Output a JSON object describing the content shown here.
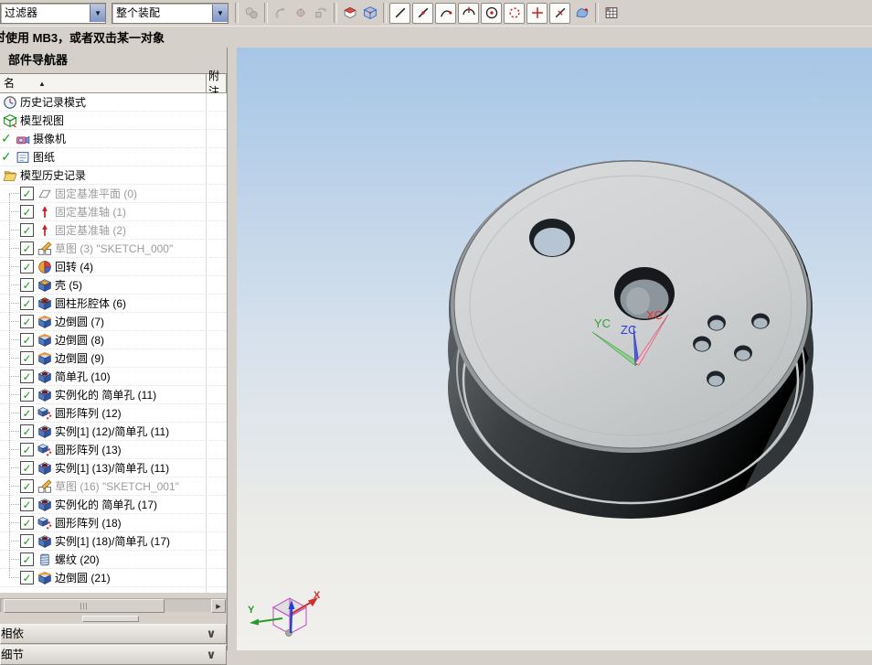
{
  "toolbar": {
    "filter_dropdown": {
      "value": "过滤器"
    },
    "scope_dropdown": {
      "value": "整个装配"
    },
    "icon_groups": [
      {
        "icons": [
          {
            "name": "component-preview-icon",
            "disabled": true
          }
        ]
      },
      {
        "icons": [
          {
            "name": "move-component-icon",
            "disabled": true
          },
          {
            "name": "rotate-component-icon",
            "disabled": true
          },
          {
            "name": "replace-component-icon",
            "disabled": true
          }
        ]
      },
      {
        "icons": [
          {
            "name": "edit-work-section-icon",
            "disabled": false
          },
          {
            "name": "clip-box-icon",
            "disabled": false
          }
        ]
      },
      {
        "icons": [
          {
            "name": "end-point-icon",
            "raised": true
          },
          {
            "name": "mid-point-icon",
            "raised": true
          },
          {
            "name": "control-point-icon",
            "raised": true
          },
          {
            "name": "quadrant-point-icon",
            "raised": true
          },
          {
            "name": "arc-center-point-icon",
            "raised": true
          },
          {
            "name": "existing-point-icon",
            "raised": true
          },
          {
            "name": "intersection-point-icon",
            "raised": true
          },
          {
            "name": "point-on-curve-icon",
            "raised": true
          },
          {
            "name": "point-on-face-icon",
            "disabled": false
          }
        ]
      },
      {
        "icons": [
          {
            "name": "spreadsheet-icon",
            "disabled": false
          }
        ]
      }
    ]
  },
  "statusbar": {
    "prefix_fragment": "时",
    "text": "使用 MB3，或者双击某一对象"
  },
  "navigator": {
    "title": "部件导航器",
    "columns": {
      "name": "名称",
      "sort_indicator": "▲",
      "note": "附注"
    },
    "rows": [
      {
        "label": "历史记录模式",
        "icon": "history",
        "check": "none",
        "child": false
      },
      {
        "label": "模型视图",
        "icon": "views",
        "check": "none",
        "child": false
      },
      {
        "label": "摄像机",
        "icon": "camera",
        "check": "mark",
        "child": false
      },
      {
        "label": "图纸",
        "icon": "sheet",
        "check": "mark",
        "child": false
      },
      {
        "label": "模型历史记录",
        "icon": "folder",
        "check": "none",
        "child": false
      },
      {
        "label": "固定基准平面 (0)",
        "icon": "plane",
        "check": "box",
        "child": true,
        "gray": true
      },
      {
        "label": "固定基准轴 (1)",
        "icon": "axis",
        "check": "box",
        "child": true,
        "gray": true
      },
      {
        "label": "固定基准轴 (2)",
        "icon": "axis",
        "check": "box",
        "child": true,
        "gray": true
      },
      {
        "label": "草图 (3) \"SKETCH_000\"",
        "icon": "sketch",
        "check": "box",
        "child": true,
        "gray": true
      },
      {
        "label": "回转 (4)",
        "icon": "revolve",
        "check": "box",
        "child": true
      },
      {
        "label": "壳 (5)",
        "icon": "shell",
        "check": "box",
        "child": true
      },
      {
        "label": "圆柱形腔体 (6)",
        "icon": "pocket",
        "check": "box",
        "child": true
      },
      {
        "label": "边倒圆 (7)",
        "icon": "blend",
        "check": "box",
        "child": true
      },
      {
        "label": "边倒圆 (8)",
        "icon": "blend",
        "check": "box",
        "child": true
      },
      {
        "label": "边倒圆 (9)",
        "icon": "blend",
        "check": "box",
        "child": true
      },
      {
        "label": "简单孔 (10)",
        "icon": "hole",
        "check": "box",
        "child": true
      },
      {
        "label": "实例化的 简单孔 (11)",
        "icon": "hole",
        "check": "box",
        "child": true
      },
      {
        "label": "圆形阵列 (12)",
        "icon": "array",
        "check": "box",
        "child": true
      },
      {
        "label": "实例[1] (12)/简单孔 (11)",
        "icon": "hole",
        "check": "box",
        "child": true
      },
      {
        "label": "圆形阵列 (13)",
        "icon": "array",
        "check": "box",
        "child": true
      },
      {
        "label": "实例[1] (13)/简单孔 (11)",
        "icon": "hole",
        "check": "box",
        "child": true
      },
      {
        "label": "草图 (16) \"SKETCH_001\"",
        "icon": "sketch",
        "check": "box",
        "child": true,
        "gray": true
      },
      {
        "label": "实例化的 简单孔 (17)",
        "icon": "hole",
        "check": "box",
        "child": true
      },
      {
        "label": "圆形阵列 (18)",
        "icon": "array",
        "check": "box",
        "child": true
      },
      {
        "label": "实例[1] (18)/简单孔 (17)",
        "icon": "hole",
        "check": "box",
        "child": true
      },
      {
        "label": "螺纹 (20)",
        "icon": "thread",
        "check": "box",
        "child": true
      },
      {
        "label": "边倒圆 (21)",
        "icon": "blend",
        "check": "box",
        "child": true
      }
    ],
    "scrollbar": {
      "grip": "|||",
      "right_arrow": "▶"
    },
    "fold_panels": [
      {
        "label": "相依性",
        "chevron": "∨"
      },
      {
        "label": "细节",
        "chevron": "∨"
      }
    ]
  },
  "viewport": {
    "wcs_labels": {
      "x": "XC",
      "y": "YC",
      "z": "ZC"
    },
    "triad_labels": {
      "x": "X",
      "y": "Y"
    },
    "colors": {
      "x_axis": "#dd3333",
      "y_axis": "#33aa33",
      "z_axis": "#3344dd",
      "part_face": "#d2d4d5",
      "part_side": "#2c2f31",
      "bg_top": "#a6c6e6",
      "bg_bottom": "#f1f0ed"
    }
  }
}
